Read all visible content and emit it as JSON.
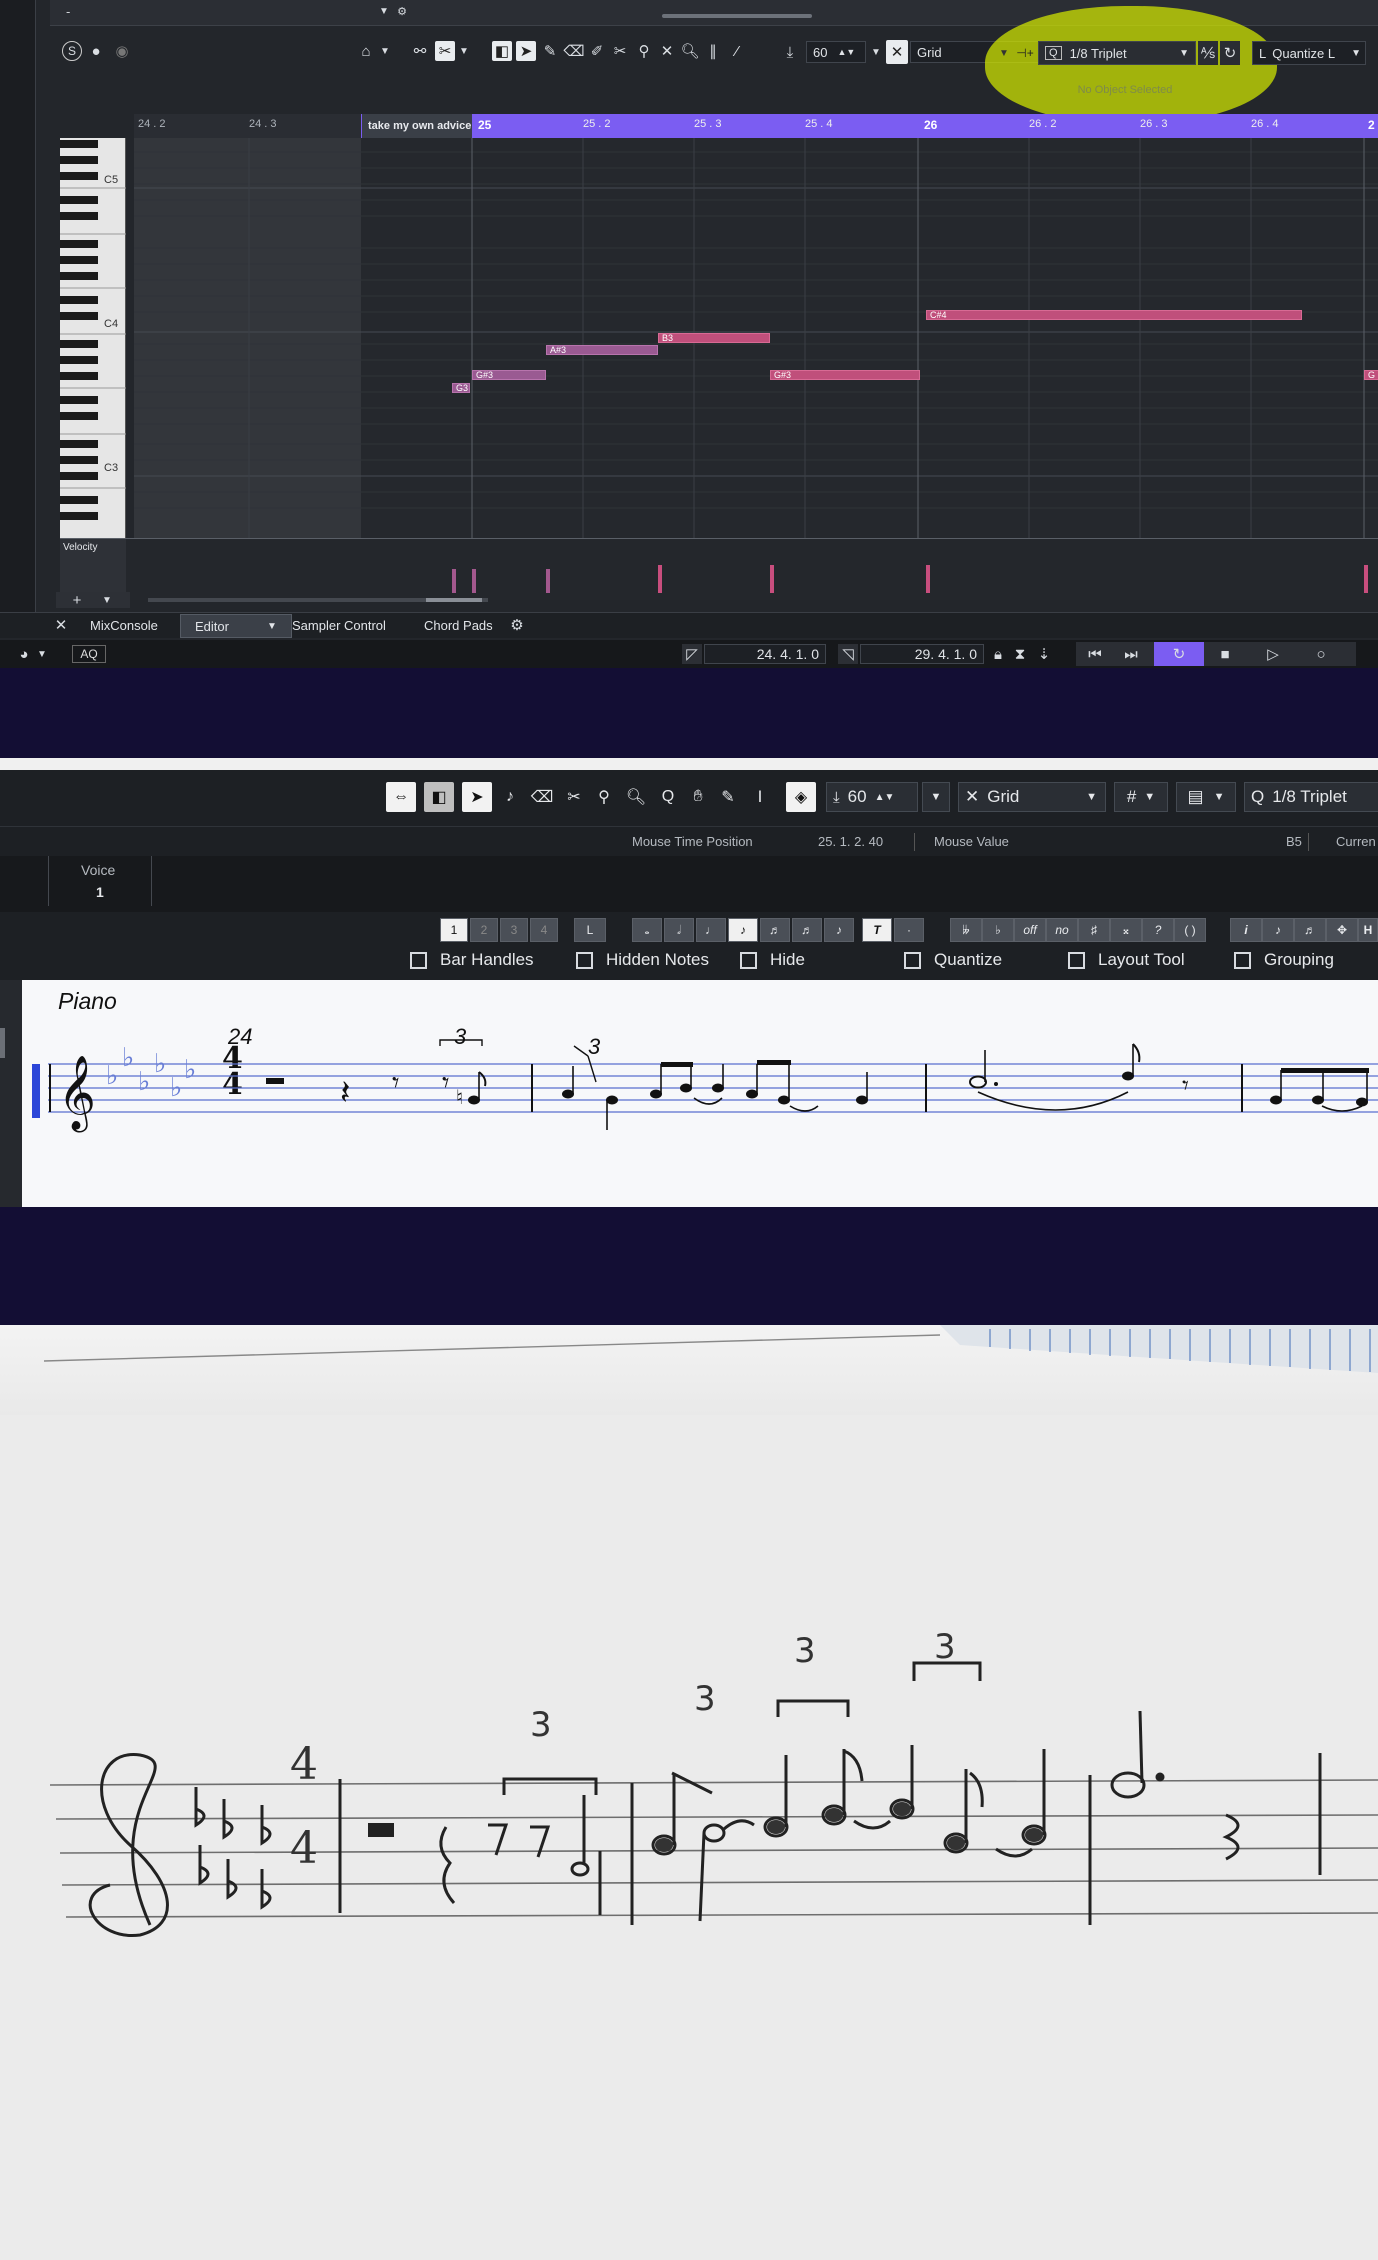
{
  "colors": {
    "note_purple": "#9a5a92",
    "note_selected": "#c04f7b",
    "ruler_accent": "#7b5df2",
    "highlight_marker": "#d4ea00",
    "navy_gap": "#130e34",
    "paper": "#ebebeb",
    "key_blue": "#6a7fd6"
  },
  "key_editor": {
    "top_track_label": "-",
    "toolbar": {
      "snap_type": "Grid",
      "quantize_icon": "Q",
      "quantize_value": "1/8 Triplet",
      "length_quantize": "Quantize L",
      "velocity_value": "60",
      "status_message": "No Object Selected"
    },
    "ruler": {
      "labels": [
        "24 . 2",
        "24 . 3",
        "25",
        "25 . 2",
        "25 . 3",
        "25 . 4",
        "26",
        "26 . 2",
        "26 . 3",
        "26 . 4",
        "2"
      ],
      "part_name": "take my own advice"
    },
    "keyboard_labels": [
      "C5",
      "C4",
      "C3"
    ],
    "notes": [
      {
        "pitch": "G3",
        "label": "G3"
      },
      {
        "pitch": "G#3",
        "label": "G#3"
      },
      {
        "pitch": "A#3",
        "label": "A#3"
      },
      {
        "pitch": "B3",
        "label": "B3"
      },
      {
        "pitch": "G#3",
        "label": "G#3"
      },
      {
        "pitch": "C#4",
        "label": "C#4"
      },
      {
        "pitch": "G#3",
        "label": "G"
      }
    ],
    "velocity_lane_label": "Velocity",
    "lower_tabs": [
      "MixConsole",
      "Editor",
      "Sampler Control",
      "Chord Pads"
    ],
    "transport": {
      "aq_label": "AQ",
      "left_locator": "24. 4. 1.    0",
      "right_locator": "29. 4. 1.    0"
    }
  },
  "score_editor": {
    "toolbar": {
      "velocity_value": "60",
      "snap_type": "Grid",
      "quantize_icon": "Q",
      "quantize_value": "1/8 Triplet"
    },
    "info_line": {
      "mouse_time_label": "Mouse Time Position",
      "mouse_time_value": "25. 1. 2. 40",
      "mouse_value_label": "Mouse Value",
      "mouse_value_value": "B5",
      "current_label": "Curren"
    },
    "voice": {
      "label": "Voice",
      "value": "1"
    },
    "voice_tabs": [
      "1",
      "2",
      "3",
      "4",
      "L"
    ],
    "accidentals": [
      "𝄫",
      "♭",
      "off",
      "no",
      "♯",
      "𝄪",
      "?",
      "( )"
    ],
    "checkboxes": [
      "Bar Handles",
      "Hidden Notes",
      "Hide",
      "Quantize",
      "Layout Tool",
      "Grouping"
    ],
    "score": {
      "instrument": "Piano",
      "bar_number": "24",
      "time_signature": {
        "numerator": "4",
        "denominator": "4"
      },
      "tuplet_numbers": [
        "3",
        "3"
      ]
    }
  },
  "handwritten": {
    "time_signature": {
      "numerator": "4",
      "denominator": "4"
    },
    "tuplet_numbers": [
      "3",
      "3",
      "3",
      "3"
    ]
  }
}
